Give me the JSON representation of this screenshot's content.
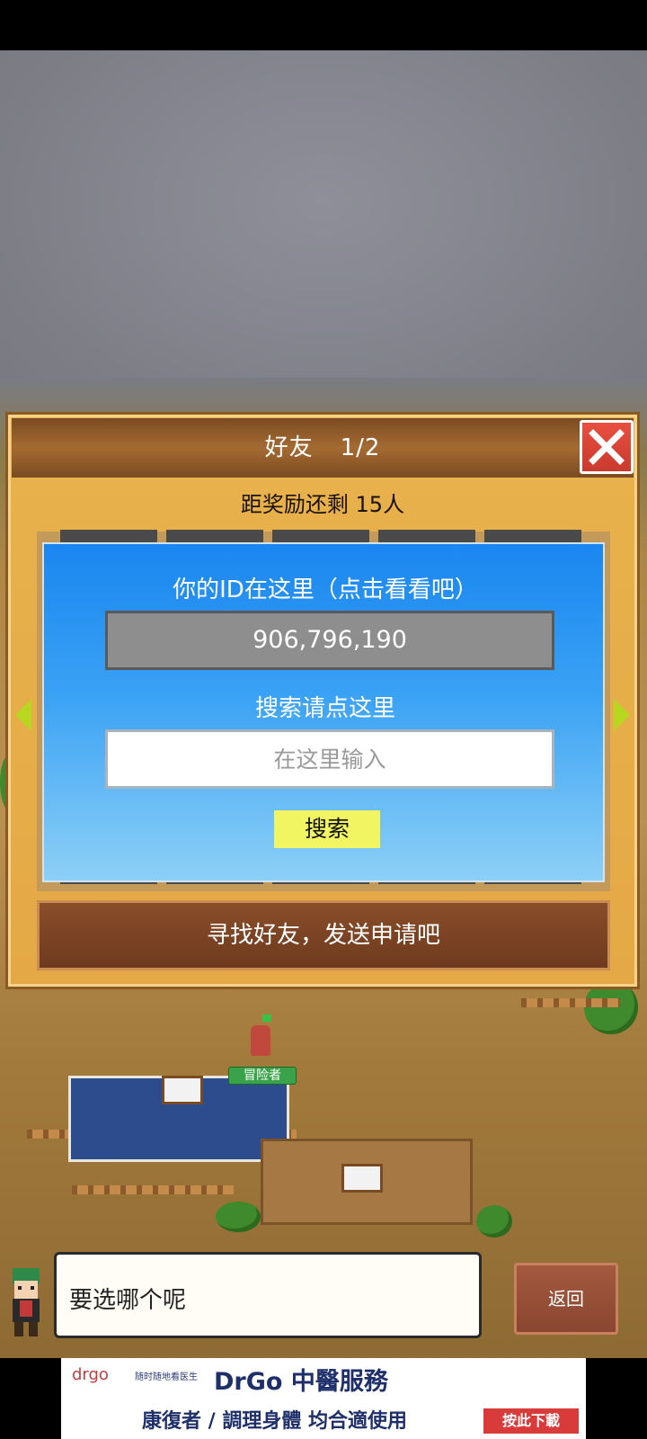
{
  "dialog": {
    "title": "好友",
    "page": "1/2",
    "reward_text": "距奖励还剩 15人",
    "id_label": "你的ID在这里（点击看看吧）",
    "id_value": "906,796,190",
    "search_label": "搜索请点这里",
    "search_placeholder": "在这里输入",
    "search_button": "搜索",
    "find_friends": "寻找好友，发送申请吧",
    "close_icon": "close-icon"
  },
  "world": {
    "adventurer_tag": "冒险者"
  },
  "message": {
    "text": "要选哪个呢",
    "back_label": "返回"
  },
  "ad": {
    "brand": "drgo",
    "brand_sub": "随时随地看医生",
    "headline": "DrGo 中醫服務",
    "tagline": "康復者 / 調理身體  均合適使用",
    "download": "按此下載"
  },
  "colors": {
    "panel_blue": "#1a86f0",
    "search_button": "#f2f562",
    "close_red": "#e94f3f",
    "dialog_gold": "#e8b24c"
  }
}
